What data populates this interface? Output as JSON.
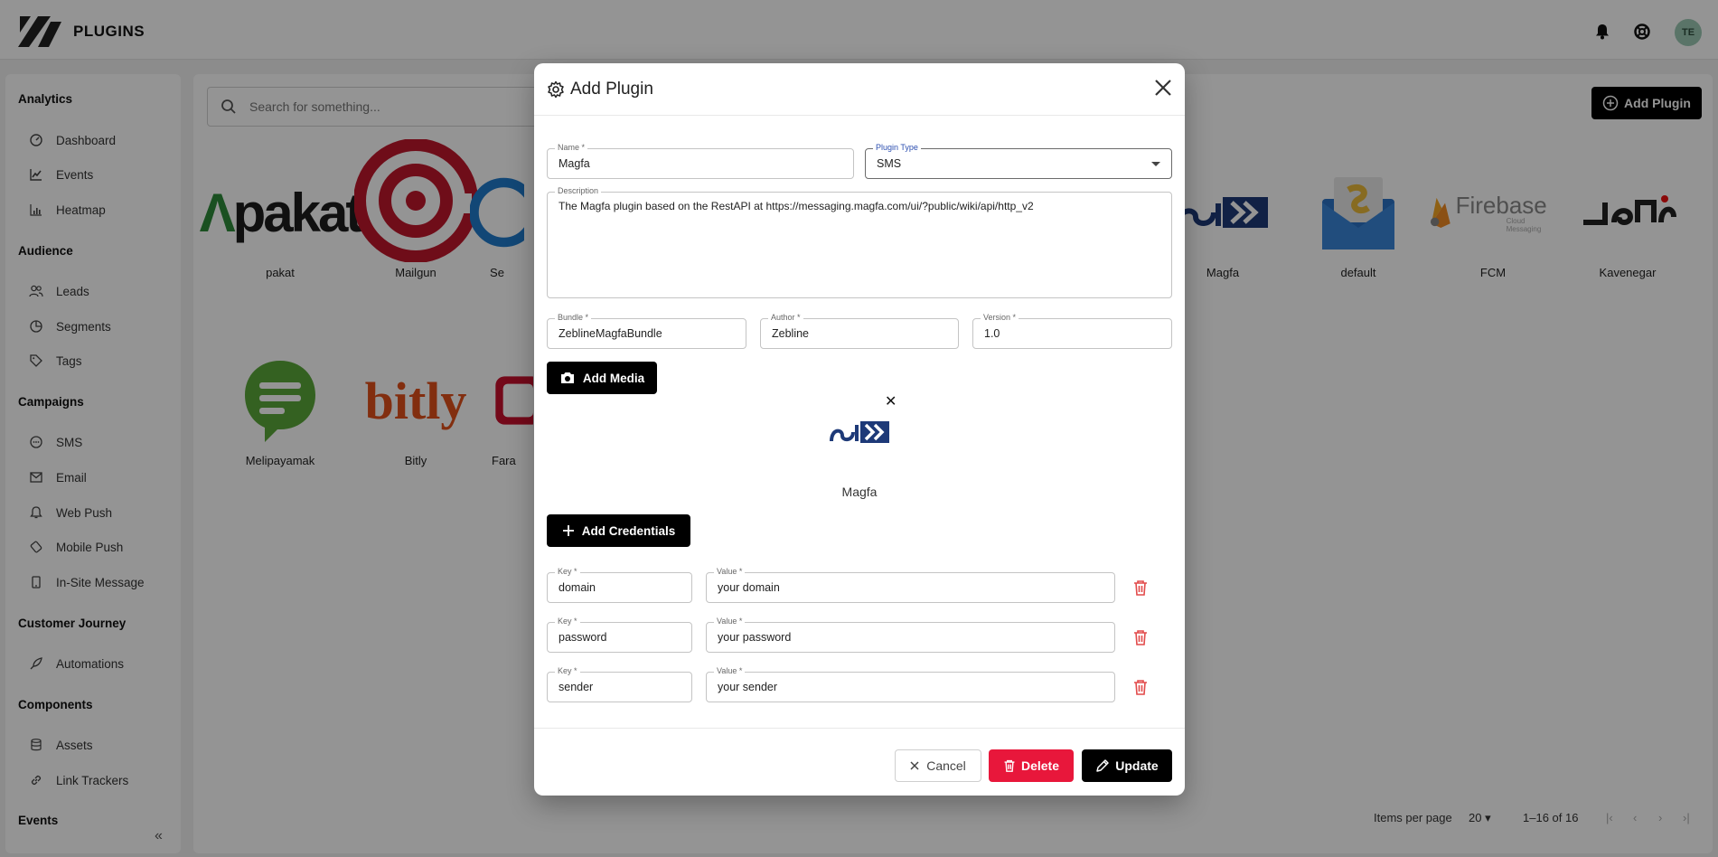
{
  "header": {
    "brand": "PLUGINS",
    "avatar": "TE"
  },
  "sidebar": {
    "sections": [
      {
        "title": "Analytics",
        "items": [
          {
            "label": "Dashboard",
            "icon": "gauge-icon"
          },
          {
            "label": "Events",
            "icon": "line-chart-icon"
          },
          {
            "label": "Heatmap",
            "icon": "bar-chart-icon"
          }
        ]
      },
      {
        "title": "Audience",
        "items": [
          {
            "label": "Leads",
            "icon": "users-icon"
          },
          {
            "label": "Segments",
            "icon": "pie-icon"
          },
          {
            "label": "Tags",
            "icon": "tag-icon"
          }
        ]
      },
      {
        "title": "Campaigns",
        "items": [
          {
            "label": "SMS",
            "icon": "sms-icon"
          },
          {
            "label": "Email",
            "icon": "mail-icon"
          },
          {
            "label": "Web Push",
            "icon": "bell-icon"
          },
          {
            "label": "Mobile Push",
            "icon": "mobile-push-icon"
          },
          {
            "label": "In-Site Message",
            "icon": "tablet-icon"
          }
        ]
      },
      {
        "title": "Customer Journey",
        "items": [
          {
            "label": "Automations",
            "icon": "rocket-icon"
          }
        ]
      },
      {
        "title": "Components",
        "items": [
          {
            "label": "Assets",
            "icon": "database-icon"
          },
          {
            "label": "Link Trackers",
            "icon": "link-icon"
          }
        ]
      },
      {
        "title": "Events",
        "items": []
      }
    ]
  },
  "main": {
    "search_placeholder": "Search for something...",
    "add_plugin_label": "Add Plugin",
    "plugins": [
      {
        "name": "pakat"
      },
      {
        "name": "Mailgun"
      },
      {
        "name": "Se"
      },
      {
        "name": "Magfa"
      },
      {
        "name": "default"
      },
      {
        "name": "FCM"
      },
      {
        "name": "Kavenegar"
      },
      {
        "name": "Melipayamak"
      },
      {
        "name": "Bitly"
      },
      {
        "name": "Fara"
      }
    ],
    "logo_text": {
      "pakat": "pakat",
      "bitly": "bitly",
      "firebase": "Firebase",
      "firebase_sub": "Cloud Messaging"
    },
    "pager": {
      "items_per_page_label": "Items per page",
      "items_per_page": "20",
      "range": "1–16 of 16"
    }
  },
  "modal": {
    "title": "Add Plugin",
    "name": {
      "label": "Name *",
      "value": "Magfa"
    },
    "plugin_type": {
      "label": "Plugin Type",
      "value": "SMS"
    },
    "description": {
      "label": "Description",
      "value": "The Magfa plugin based on the RestAPI at https://messaging.magfa.com/ui/?public/wiki/api/http_v2"
    },
    "bundle": {
      "label": "Bundle *",
      "value": "ZeblineMagfaBundle"
    },
    "author": {
      "label": "Author *",
      "value": "Zebline"
    },
    "version": {
      "label": "Version *",
      "value": "1.0"
    },
    "add_media_label": "Add Media",
    "media_name": "Magfa",
    "add_credentials_label": "Add Credentials",
    "credentials": [
      {
        "key_label": "Key *",
        "key": "domain",
        "value_label": "Value *",
        "value": "your domain"
      },
      {
        "key_label": "Key *",
        "key": "password",
        "value_label": "Value *",
        "value": "your password"
      },
      {
        "key_label": "Key *",
        "key": "sender",
        "value_label": "Value *",
        "value": "your sender"
      }
    ],
    "cancel_label": "Cancel",
    "delete_label": "Delete",
    "update_label": "Update"
  },
  "colors": {
    "accent": "#000000",
    "danger": "#e8173b",
    "trash": "#e24a4a",
    "focus_label": "#2d4fb0"
  }
}
